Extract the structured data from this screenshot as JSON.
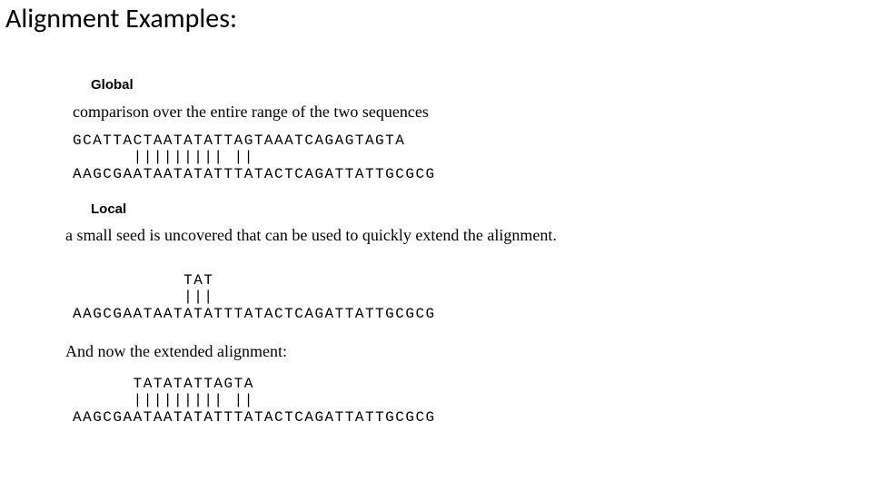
{
  "title": "Alignment Examples:",
  "global": {
    "label": "Global",
    "desc": "comparison over the entire range of the two sequences",
    "seq1": "GCATTACTAATATATTAGTAAATCAGAGTAGTA",
    "match": "      ||||||||| ||",
    "seq2": "AAGCGAATAATATATTTATACTCAGATTATTGCGCG"
  },
  "local": {
    "label": "Local",
    "desc": "a small seed is uncovered that can be used to quickly extend the alignment.",
    "seq1": "           TAT",
    "match": "           |||",
    "seq2": "AAGCGAATAATATATTTATACTCAGATTATTGCGCG"
  },
  "extended": {
    "desc": "And now the extended alignment:",
    "seq1": "      TATATATTAGTA",
    "match": "      ||||||||| ||",
    "seq2": "AAGCGAATAATATATTTATACTCAGATTATTGCGCG"
  }
}
